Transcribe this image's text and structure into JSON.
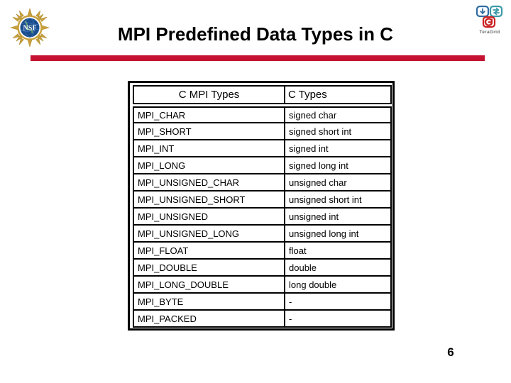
{
  "slide": {
    "title": "MPI Predefined Data Types in C",
    "page_number": "6",
    "accent_color": "#c41230"
  },
  "logos": {
    "nsf": {
      "name": "NSF",
      "wordmark": "NSF",
      "globe_color": "#1b4c8c",
      "ray_color": "#c8a03c"
    },
    "teragrid": {
      "name": "TeraGrid",
      "wordmark": "TeraGrid",
      "tile_top_left_color": "#2e6da4",
      "tile_top_right_color": "#3a9aa8",
      "tile_bottom_color": "#cc2222"
    }
  },
  "table": {
    "headers": [
      "C MPI Types",
      "C Types"
    ],
    "rows": [
      {
        "mpi": "MPI_CHAR",
        "c": "signed char"
      },
      {
        "mpi": "MPI_SHORT",
        "c": "signed short int"
      },
      {
        "mpi": "MPI_INT",
        "c": "signed int"
      },
      {
        "mpi": "MPI_LONG",
        "c": "signed long int"
      },
      {
        "mpi": "MPI_UNSIGNED_CHAR",
        "c": "unsigned char"
      },
      {
        "mpi": "MPI_UNSIGNED_SHORT",
        "c": "unsigned short int"
      },
      {
        "mpi": "MPI_UNSIGNED",
        "c": "unsigned int"
      },
      {
        "mpi": "MPI_UNSIGNED_LONG",
        "c": "unsigned long int"
      },
      {
        "mpi": "MPI_FLOAT",
        "c": "float"
      },
      {
        "mpi": "MPI_DOUBLE",
        "c": "double"
      },
      {
        "mpi": "MPI_LONG_DOUBLE",
        "c": "long double"
      },
      {
        "mpi": "MPI_BYTE",
        "c": "-"
      },
      {
        "mpi": "MPI_PACKED",
        "c": "-"
      }
    ]
  }
}
